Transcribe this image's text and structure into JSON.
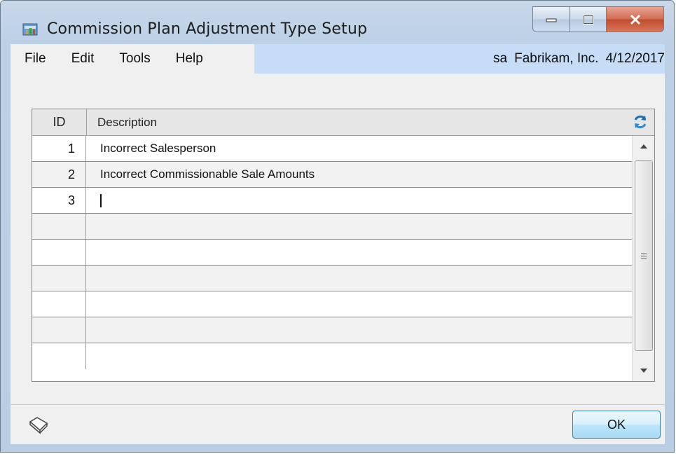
{
  "window": {
    "title": "Commission Plan Adjustment Type Setup"
  },
  "menu": {
    "items": [
      "File",
      "Edit",
      "Tools",
      "Help"
    ],
    "user": "sa",
    "company": "Fabrikam, Inc.",
    "date": "4/12/2017"
  },
  "grid": {
    "columns": [
      "ID",
      "Description"
    ],
    "rows": [
      {
        "id": "1",
        "description": "Incorrect Salesperson"
      },
      {
        "id": "2",
        "description": "Incorrect Commissionable Sale Amounts"
      },
      {
        "id": "3",
        "description": ""
      },
      {
        "id": "",
        "description": ""
      },
      {
        "id": "",
        "description": ""
      },
      {
        "id": "",
        "description": ""
      },
      {
        "id": "",
        "description": ""
      },
      {
        "id": "",
        "description": ""
      },
      {
        "id": "",
        "description": ""
      }
    ]
  },
  "footer": {
    "ok_label": "OK"
  },
  "icons": {
    "app": "commission-setup-icon",
    "refresh": "refresh-icon",
    "note": "note-icon"
  }
}
